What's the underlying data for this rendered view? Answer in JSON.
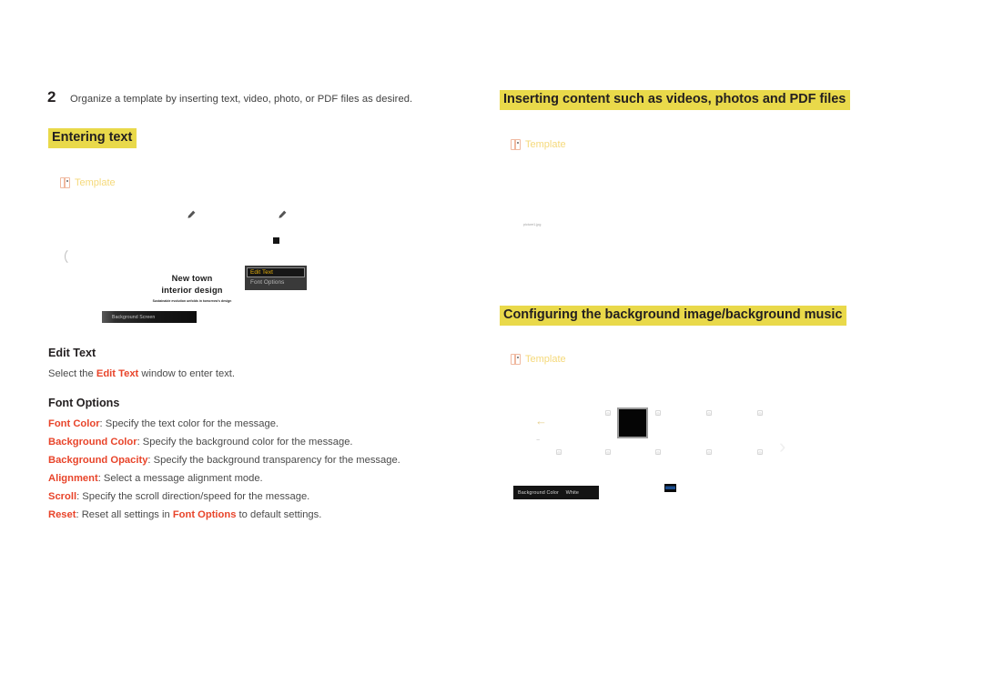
{
  "step": {
    "number": "2",
    "text": "Organize a template by inserting text, video, photo, or PDF files as desired."
  },
  "headings": {
    "entering_text": "Entering text",
    "inserting_content": "Inserting content such as videos, photos and PDF files",
    "configuring_background": "Configuring the background image/background music"
  },
  "captions": {
    "template": "Template"
  },
  "left_mockup": {
    "title_line1": "New town",
    "title_line2": "interior design",
    "subtitle": "Sustainable evolution unfolds in tomorrow's design",
    "menu": [
      {
        "label": "Edit Text",
        "selected": true
      },
      {
        "label": "Font Options",
        "selected": false
      }
    ],
    "bottom_bar": "Background Screen"
  },
  "top_right_mockup": {
    "file_label": "picture1.jpg"
  },
  "bottom_right_mockup": {
    "setting_label": "Background Color",
    "setting_value": "White"
  },
  "sections": [
    {
      "heading": "Edit Text",
      "lines": [
        [
          {
            "t": "Select the ",
            "s": "bk"
          },
          {
            "t": "Edit Text",
            "s": "rd"
          },
          {
            "t": " window to enter text.",
            "s": "bk"
          }
        ]
      ]
    },
    {
      "heading": "Font Options",
      "lines": [
        [
          {
            "t": "Font Color",
            "s": "rd"
          },
          {
            "t": ": Specify the text color for the message.",
            "s": "bk"
          }
        ],
        [
          {
            "t": "Background Color",
            "s": "rd"
          },
          {
            "t": ": Specify the background color for the message.",
            "s": "bk"
          }
        ],
        [
          {
            "t": "Background Opacity",
            "s": "rd"
          },
          {
            "t": ": Specify the background transparency for the message.",
            "s": "bk"
          }
        ],
        [
          {
            "t": "Alignment",
            "s": "rd"
          },
          {
            "t": ": Select a message alignment mode.",
            "s": "bk"
          }
        ],
        [
          {
            "t": "Scroll",
            "s": "rd"
          },
          {
            "t": ": Specify the scroll direction/speed for the message.",
            "s": "bk"
          }
        ],
        [
          {
            "t": "Reset",
            "s": "rd"
          },
          {
            "t": ": Reset all settings in ",
            "s": "bk"
          },
          {
            "t": "Font Options",
            "s": "rd"
          },
          {
            "t": " to default settings.",
            "s": "bk"
          }
        ]
      ]
    }
  ],
  "colors": {
    "highlight": "#e9d94a",
    "accent_red": "#e8442a",
    "caption_gold": "#f5d97a",
    "body_text": "#4a4a4a"
  }
}
